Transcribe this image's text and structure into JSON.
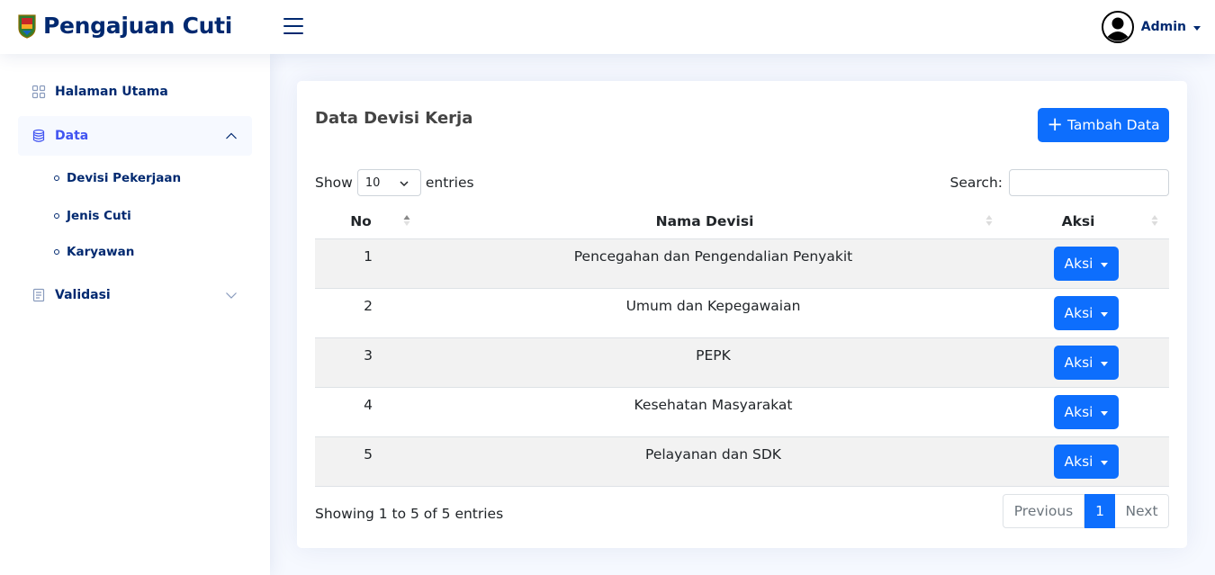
{
  "header": {
    "app_title": "Pengajuan Cuti",
    "user_name": "Admin",
    "icons": {
      "logo": "crest-logo-icon",
      "menu": "hamburger-menu-icon",
      "avatar": "user-avatar-icon"
    }
  },
  "sidebar": {
    "items": [
      {
        "label": "Halaman Utama",
        "icon": "grid-icon"
      },
      {
        "label": "Data",
        "icon": "database-icon",
        "expanded": true
      },
      {
        "label": "Validasi",
        "icon": "journal-icon",
        "expanded": false
      }
    ],
    "data_subitems": [
      {
        "label": "Devisi Pekerjaan"
      },
      {
        "label": "Jenis Cuti"
      },
      {
        "label": "Karyawan"
      }
    ]
  },
  "card": {
    "title": "Data Devisi Kerja",
    "add_button_label": "Tambah Data",
    "show_label": "Show",
    "entries_label": "entries",
    "entries_value": "10",
    "search_label": "Search:",
    "search_value": ""
  },
  "table": {
    "columns": [
      "No",
      "Nama Devisi",
      "Aksi"
    ],
    "rows": [
      {
        "no": "1",
        "nama": "Pencegahan dan Pengendalian Penyakit",
        "aksi": "Aksi"
      },
      {
        "no": "2",
        "nama": "Umum dan Kepegawaian",
        "aksi": "Aksi"
      },
      {
        "no": "3",
        "nama": "PEPK",
        "aksi": "Aksi"
      },
      {
        "no": "4",
        "nama": "Kesehatan Masyarakat",
        "aksi": "Aksi"
      },
      {
        "no": "5",
        "nama": "Pelayanan dan SDK",
        "aksi": "Aksi"
      }
    ]
  },
  "footer": {
    "info": "Showing 1 to 5 of 5 entries",
    "pagination": {
      "previous": "Previous",
      "current": "1",
      "next": "Next"
    }
  },
  "colors": {
    "primary": "#0d6efd",
    "nav_text": "#012970",
    "nav_active": "#4154f1",
    "page_bg": "#f6f9ff"
  }
}
